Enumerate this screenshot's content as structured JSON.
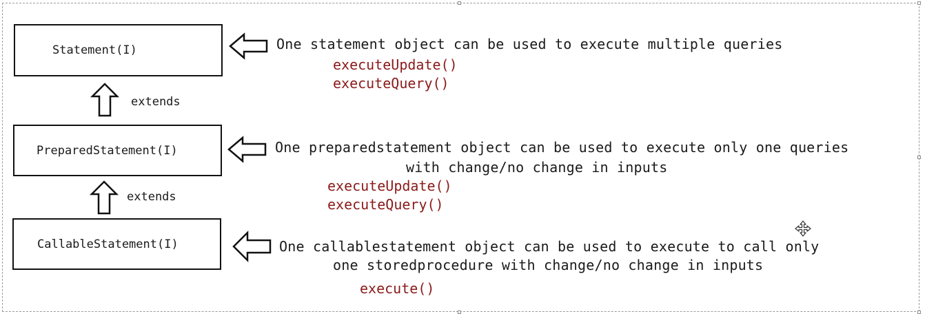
{
  "boxes": {
    "statement": "Statement(I)",
    "prepared": "PreparedStatement(I)",
    "callable": "CallableStatement(I)"
  },
  "extends_label": "extends",
  "descriptions": {
    "statement": "One statement object can be used to execute multiple queries",
    "prepared_line1": "One preparedstatement object can be used to execute only one queries",
    "prepared_line2": "with change/no change in inputs",
    "callable_line1": "One callablestatement object can be used to execute to call only",
    "callable_line2": "one storedprocedure with change/no change in inputs"
  },
  "methods": {
    "statement": [
      "executeUpdate()",
      "executeQuery()"
    ],
    "prepared": [
      "executeUpdate()",
      "executeQuery()"
    ],
    "callable": [
      "execute()"
    ]
  },
  "colors": {
    "method_text": "#8b1a1a",
    "border": "#111111"
  },
  "icons": {
    "move": "move-cursor-icon"
  }
}
